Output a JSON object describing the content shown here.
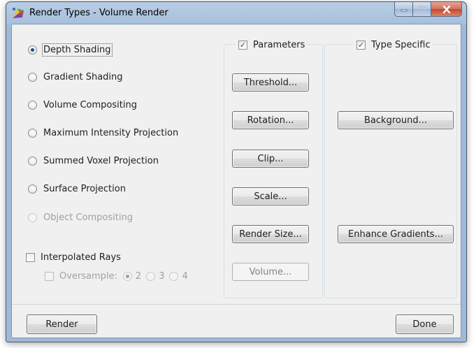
{
  "window": {
    "title": "Render Types - Volume Render"
  },
  "render_types": [
    {
      "label": "Depth Shading",
      "checked": true,
      "enabled": true
    },
    {
      "label": "Gradient Shading",
      "checked": false,
      "enabled": true
    },
    {
      "label": "Volume Compositing",
      "checked": false,
      "enabled": true
    },
    {
      "label": "Maximum Intensity Projection",
      "checked": false,
      "enabled": true
    },
    {
      "label": "Summed Voxel Projection",
      "checked": false,
      "enabled": true
    },
    {
      "label": "Surface Projection",
      "checked": false,
      "enabled": true
    },
    {
      "label": "Object Compositing",
      "checked": false,
      "enabled": false
    }
  ],
  "interpolated_rays": {
    "label": "Interpolated Rays",
    "checked": false
  },
  "oversample": {
    "label": "Oversample:",
    "checked": false,
    "options": [
      "2",
      "3",
      "4"
    ],
    "selected": "2"
  },
  "parameters": {
    "label": "Parameters",
    "checked": true,
    "buttons": {
      "threshold": "Threshold...",
      "rotation": "Rotation...",
      "clip": "Clip...",
      "scale": "Scale...",
      "render_size": "Render Size...",
      "volume": "Volume..."
    }
  },
  "type_specific": {
    "label": "Type Specific",
    "checked": true,
    "buttons": {
      "background": "Background...",
      "enhance_gradients": "Enhance Gradients..."
    }
  },
  "footer": {
    "render_label": "Render",
    "done_label": "Done"
  },
  "colors": {
    "title_bar": "#a7c0de",
    "client_bg": "#f0f0f0",
    "close_button": "#c14a2f",
    "radio_dot": "#1f4a8a"
  }
}
